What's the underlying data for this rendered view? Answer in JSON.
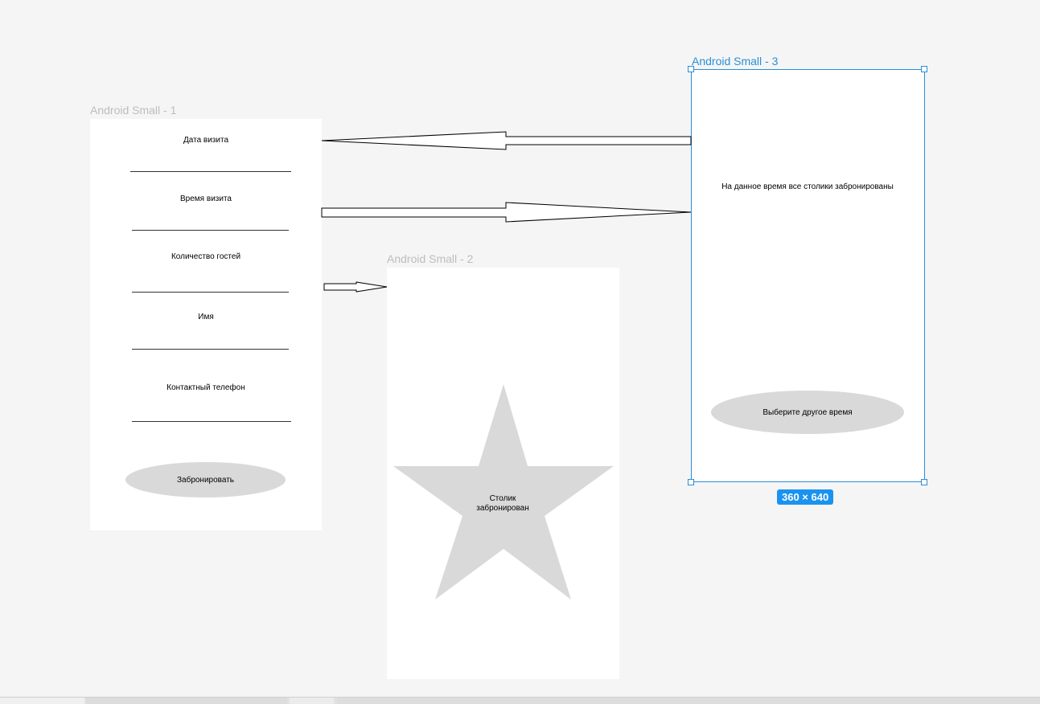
{
  "frames": {
    "frame1": {
      "title": "Android Small - 1",
      "fields": [
        {
          "label": "Дата визита"
        },
        {
          "label": "Время визита"
        },
        {
          "label": "Количество гостей"
        },
        {
          "label": "Имя"
        },
        {
          "label": "Контактный телефон"
        }
      ],
      "button_label": "Забронировать"
    },
    "frame2": {
      "title": "Android Small - 2",
      "star_text_line1": "Столик",
      "star_text_line2": "забронирован"
    },
    "frame3": {
      "title": "Android Small - 3",
      "message": "На данное время все столики забронированы",
      "button_label": "Выберите другое время"
    }
  },
  "selection": {
    "size_badge": "360 × 640"
  },
  "colors": {
    "canvas_bg": "#f5f5f5",
    "frame_bg": "#ffffff",
    "shape_fill": "#d9d9d9",
    "selection_accent": "#2a8fd6",
    "badge_bg": "#1a93f0"
  }
}
